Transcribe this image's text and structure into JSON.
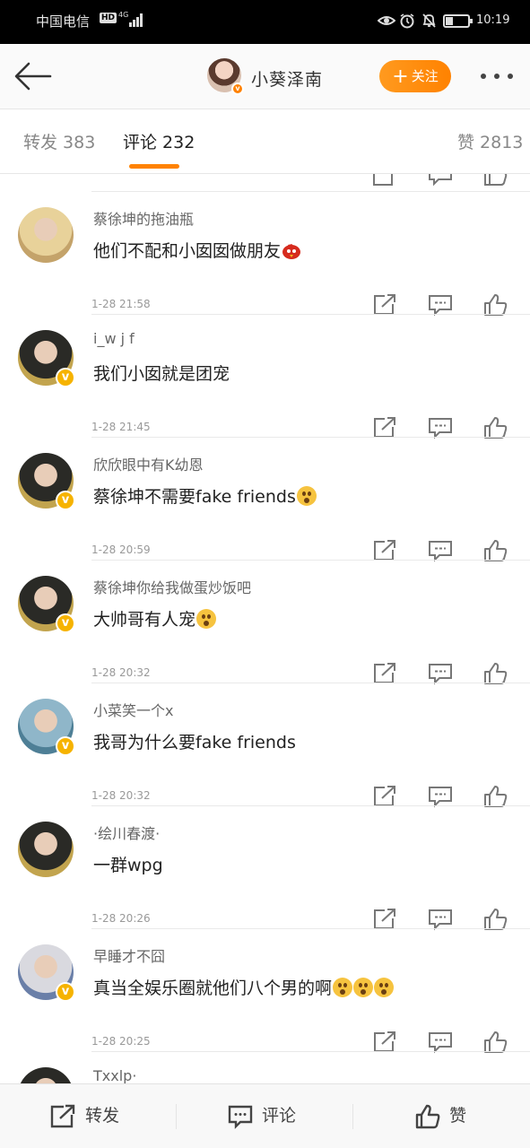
{
  "status_bar": {
    "carrier": "中国电信",
    "hd": "HD",
    "network": "4G",
    "time": "10:19"
  },
  "nav": {
    "title": "小葵泽南",
    "follow_label": "关注",
    "verified_badge": "v"
  },
  "tabs": [
    {
      "label": "转发 383",
      "active": false
    },
    {
      "label": "评论 232",
      "active": true
    },
    {
      "label": "赞 2813",
      "active": false
    }
  ],
  "comments": [
    {
      "username": "蔡徐坤的拖油瓶",
      "text": "他们不配和小囡囡做朋友",
      "emoji": "angry-bird",
      "time": "1-28 21:58",
      "avatar_colors": [
        "#e8d29a",
        "#c4a36a"
      ],
      "verified": false
    },
    {
      "username": "i_w j f",
      "text": "我们小囡就是团宠",
      "emoji": "",
      "time": "1-28 21:45",
      "avatar_colors": [
        "#2a2a26",
        "#c2a44e"
      ],
      "verified": true
    },
    {
      "username": "欣欣眼中有K幼恩",
      "text": "蔡徐坤不需要fake friends",
      "emoji": "thinking",
      "time": "1-28 20:59",
      "avatar_colors": [
        "#2a2a26",
        "#c2a44e"
      ],
      "verified": true
    },
    {
      "username": "蔡徐坤你给我做蛋炒饭吧",
      "text": "大帅哥有人宠",
      "emoji": "shy",
      "time": "1-28 20:32",
      "avatar_colors": [
        "#2a2a26",
        "#c2a44e"
      ],
      "verified": true
    },
    {
      "username": "小菜笑一个x",
      "text": "我哥为什么要fake friends",
      "emoji": "",
      "time": "1-28 20:32",
      "avatar_colors": [
        "#8fb6c9",
        "#4e7f96"
      ],
      "verified": true
    },
    {
      "username": "·绘川春渡·",
      "text": "一群wpg",
      "emoji": "",
      "time": "1-28 20:26",
      "avatar_colors": [
        "#2a2a26",
        "#c2a44e"
      ],
      "verified": false
    },
    {
      "username": "早睡才不囧",
      "text": "真当全娱乐圈就他们八个男的啊",
      "emoji": "surprised-x3",
      "time": "1-28 20:25",
      "avatar_colors": [
        "#d9d9df",
        "#6a7fa8"
      ],
      "verified": true
    },
    {
      "username": "Txxlp·",
      "text": "",
      "emoji": "",
      "time": "",
      "avatar_colors": [
        "#2a2a26",
        "#c2a44e"
      ],
      "verified": false
    }
  ],
  "bottom_bar": {
    "repost_label": "转发",
    "comment_label": "评论",
    "like_label": "赞"
  },
  "colors": {
    "accent": "#ff8200",
    "verified": "#f6b300"
  }
}
